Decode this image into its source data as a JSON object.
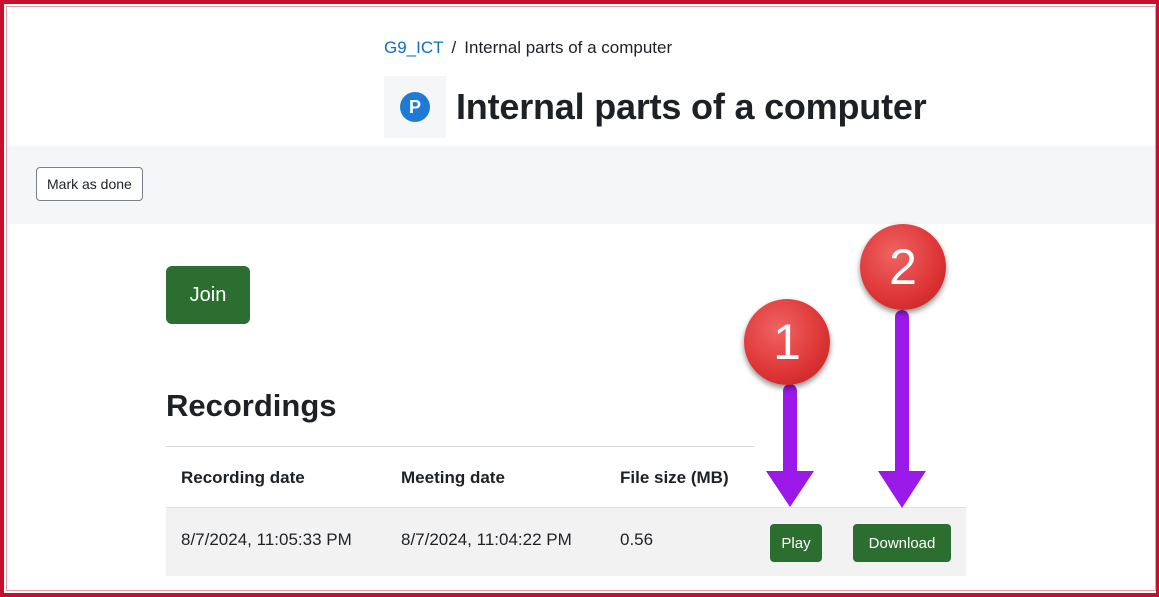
{
  "breadcrumb": {
    "course": "G9_ICT",
    "separator": "/",
    "current": "Internal parts of a computer"
  },
  "header": {
    "icon": "p-icon",
    "title": "Internal parts of a computer"
  },
  "activity": {
    "mark_done_label": "Mark as done"
  },
  "join_label": "Join",
  "recordings": {
    "heading": "Recordings",
    "columns": [
      "Recording date",
      "Meeting date",
      "File size (MB)"
    ],
    "rows": [
      {
        "recording_date": "8/7/2024, 11:05:33 PM",
        "meeting_date": "8/7/2024, 11:04:22 PM",
        "file_size": "0.56",
        "play_label": "Play",
        "download_label": "Download"
      }
    ]
  },
  "annotations": {
    "badge_1": "1",
    "badge_2": "2",
    "arrow_color": "#9b19e8"
  },
  "colors": {
    "accent_green": "#2b6e2f",
    "link_blue": "#0f6cbf",
    "badge_red": "#dd3434",
    "frame_red": "#c8102e"
  }
}
